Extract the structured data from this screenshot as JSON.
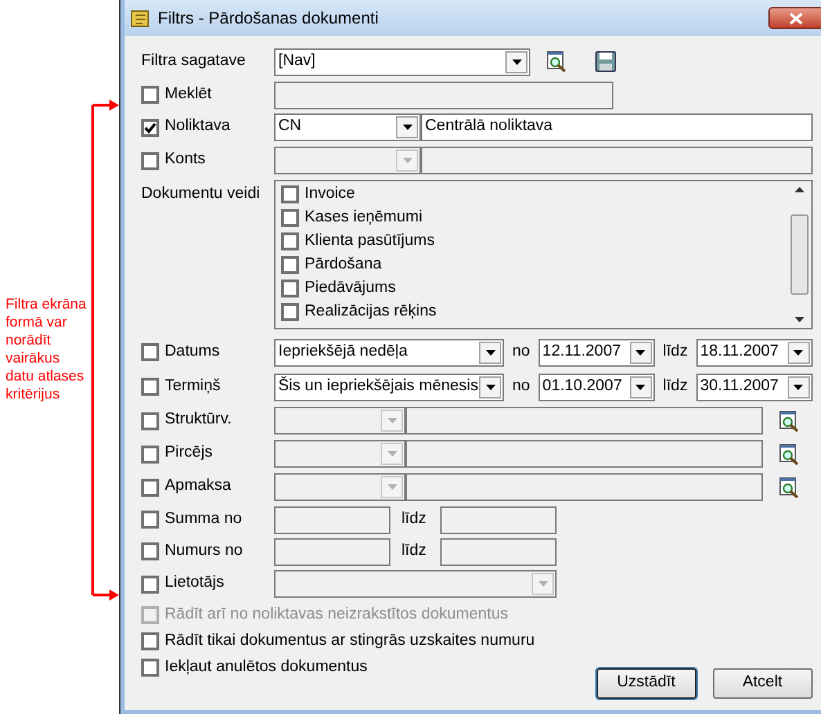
{
  "annotation": {
    "text": "Filtra ekrāna formā var norādīt vairākus datu atlases kritērijus"
  },
  "window": {
    "title": "Filtrs - Pārdošanas dokumenti"
  },
  "template": {
    "label": "Filtra sagatave",
    "value": "[Nav]"
  },
  "criteria": [
    {
      "kind": "text",
      "label": "Meklēt",
      "checked": false
    },
    {
      "kind": "lookup",
      "label": "Noliktava",
      "checked": true,
      "disabled": false,
      "code": "CN",
      "name": "Centrālā noliktava"
    },
    {
      "kind": "lookup",
      "label": "Konts",
      "checked": false,
      "disabled": true
    },
    {
      "kind": "list",
      "label": "Dokumentu veidi",
      "items": [
        {
          "label": "Invoice",
          "checked": false
        },
        {
          "label": "Kases ieņēmumi",
          "checked": false
        },
        {
          "label": "Klienta pasūtījums",
          "checked": false
        },
        {
          "label": "Pārdošana",
          "checked": false
        },
        {
          "label": "Piedāvājums",
          "checked": false
        },
        {
          "label": "Realizācijas rēķins",
          "checked": false
        }
      ]
    },
    {
      "kind": "period",
      "label": "Datums",
      "checked": false,
      "period": "Iepriekšējā nedēļa",
      "from_label": "no",
      "from": "12.11.2007",
      "to_label": "līdz",
      "to": "18.11.2007"
    },
    {
      "kind": "period",
      "label": "Termiņš",
      "checked": false,
      "period": "Šis un iepriekšējais mēnesis",
      "from_label": "no",
      "from": "01.10.2007",
      "to_label": "līdz",
      "to": "30.11.2007"
    },
    {
      "kind": "lookup_search",
      "label": "Struktūrv.",
      "checked": false,
      "disabled": true
    },
    {
      "kind": "lookup_search",
      "label": "Pircējs",
      "checked": false,
      "disabled": true
    },
    {
      "kind": "lookup_search",
      "label": "Apmaksa",
      "checked": false,
      "disabled": true
    },
    {
      "kind": "range",
      "label": "Summa no",
      "checked": false,
      "to_label": "līdz"
    },
    {
      "kind": "range",
      "label": "Numurs no",
      "checked": false,
      "to_label": "līdz"
    },
    {
      "kind": "combo",
      "label": "Lietotājs",
      "checked": false
    }
  ],
  "options": [
    {
      "label": "Rādīt arī no noliktavas neizrakstītos dokumentus",
      "checked": false,
      "disabled": true
    },
    {
      "label": "Rādīt tikai dokumentus ar stingrās uzskaites numuru",
      "checked": false,
      "disabled": false
    },
    {
      "label": "Iekļaut anulētos dokumentus",
      "checked": false,
      "disabled": false
    }
  ],
  "buttons": [
    {
      "label": "Uzstādīt",
      "default": true
    },
    {
      "label": "Atcelt",
      "default": false
    }
  ]
}
